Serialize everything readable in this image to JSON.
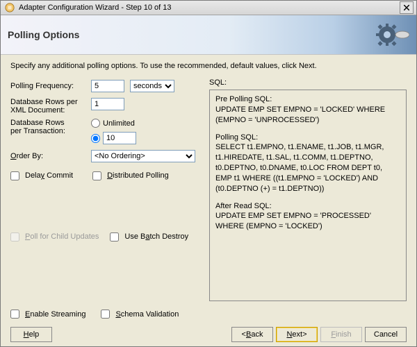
{
  "window": {
    "title": "Adapter Configuration Wizard - Step 10 of 13",
    "banner_title": "Polling Options",
    "intro": "Specify any additional polling options.  To use the recommended, default values, click Next."
  },
  "left": {
    "polling_freq_label": "Polling Frequency:",
    "polling_freq_value": "5",
    "polling_freq_unit": "seconds",
    "rows_xml_label_a": "Database Rows per",
    "rows_xml_label_b": "XML Document:",
    "rows_xml_value": "1",
    "rows_tx_label_a": "Database Rows",
    "rows_tx_label_b": "per Transaction:",
    "unlimited_label": "Unlimited",
    "tx_count_value": "10",
    "orderby_prefix": "O",
    "orderby_rest": "rder By:",
    "orderby_value": "<No Ordering>",
    "delay_commit_pre": "Dela",
    "delay_commit_u": "y",
    "delay_commit_post": " Commit",
    "distributed_u": "D",
    "distributed_rest": "istributed Polling",
    "child_u": "P",
    "child_rest": "oll for Child Updates",
    "batch_pre": "Use B",
    "batch_u": "a",
    "batch_post": "tch Destroy",
    "stream_u": "E",
    "stream_rest": "nable Streaming",
    "schema_u": "S",
    "schema_rest": "chema Validation"
  },
  "sql": {
    "label": "SQL:",
    "pre_label": "Pre Polling SQL:",
    "pre_text": "UPDATE EMP SET EMPNO = 'LOCKED' WHERE (EMPNO = 'UNPROCESSED')",
    "poll_label": "Polling SQL:",
    "poll_text": "SELECT t1.EMPNO, t1.ENAME, t1.JOB, t1.MGR, t1.HIREDATE, t1.SAL, t1.COMM, t1.DEPTNO, t0.DEPTNO, t0.DNAME, t0.LOC FROM DEPT t0, EMP t1 WHERE ((t1.EMPNO = 'LOCKED') AND (t0.DEPTNO (+) = t1.DEPTNO))",
    "after_label": "After Read SQL:",
    "after_text": "UPDATE EMP SET EMPNO = 'PROCESSED' WHERE (EMPNO = 'LOCKED')"
  },
  "buttons": {
    "help_u": "H",
    "help_rest": "elp",
    "back_lt": "< ",
    "back_u": "B",
    "back_rest": "ack",
    "next_u": "N",
    "next_rest": "ext",
    "next_gt": " >",
    "finish_u": "F",
    "finish_rest": "inish",
    "cancel": "Cancel"
  }
}
